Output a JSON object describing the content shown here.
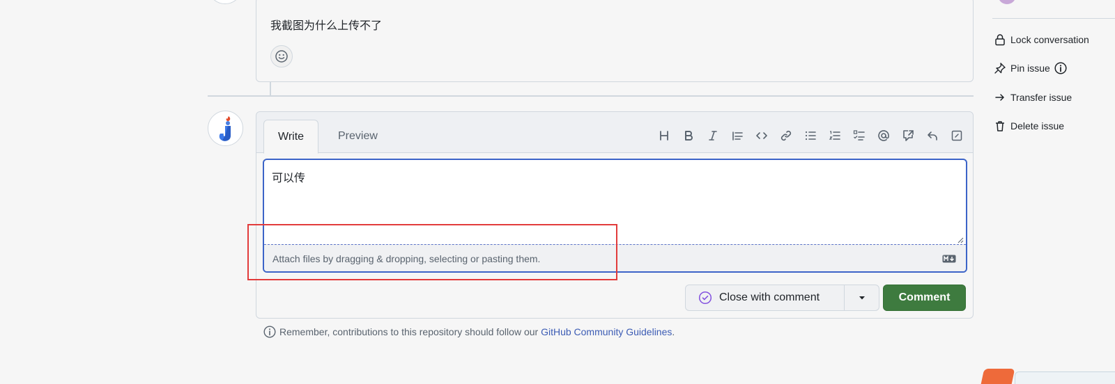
{
  "previous_comment": {
    "body": "我截图为什么上传不了"
  },
  "composer": {
    "tabs": {
      "write": "Write",
      "preview": "Preview"
    },
    "toolbar_icons": [
      "heading-icon",
      "bold-icon",
      "italic-icon",
      "quote-icon",
      "code-icon",
      "link-icon",
      "bulleted-list-icon",
      "numbered-list-icon",
      "task-list-icon",
      "mention-icon",
      "reference-icon",
      "saved-reply-icon",
      "fullscreen-icon"
    ],
    "text": "可以传",
    "attach_hint": "Attach files by dragging & dropping, selecting or pasting them.",
    "markdown_badge": "M↓",
    "close_with_comment": "Close with comment",
    "comment": "Comment"
  },
  "footer_note": {
    "text": "Remember, contributions to this repository should follow our",
    "link": "GitHub Community Guidelines",
    "period": "."
  },
  "sidebar": {
    "lock": "Lock conversation",
    "pin": "Pin issue",
    "transfer": "Transfer issue",
    "delete": "Delete issue"
  },
  "colors": {
    "accent_blue": "#3c64c8",
    "comment_green": "#3e7b3f",
    "highlight_red": "#e23b3b",
    "link_blue": "#3c5cb4",
    "close_purple": "#8250df"
  }
}
